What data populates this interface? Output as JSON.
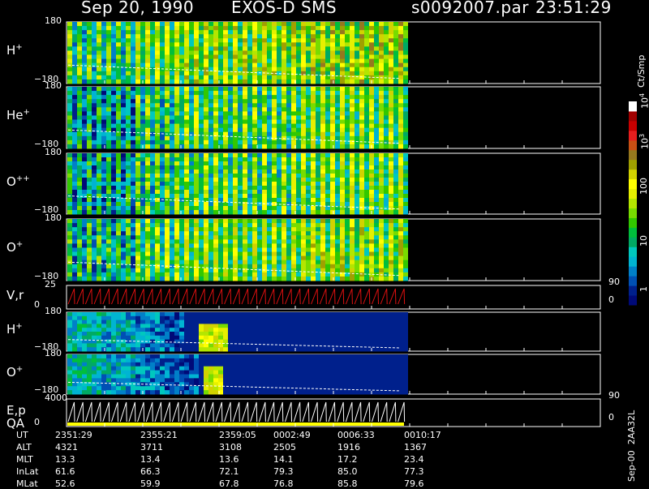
{
  "header": {
    "date": "Sep 20, 1990",
    "mission": "EXOS-D SMS",
    "file": "s0092007.par",
    "time": "23:51:29"
  },
  "colorbar": {
    "unit": "Ct/Smp",
    "labels": [
      "1",
      "10",
      "100",
      "10",
      "10"
    ],
    "label_superscripts": [
      "",
      "",
      "",
      "3",
      "4"
    ],
    "colors": [
      "#000a78",
      "#00208c",
      "#0050b4",
      "#0080c8",
      "#00b4d2",
      "#00c8be",
      "#00aa64",
      "#00be3c",
      "#32c800",
      "#78dc00",
      "#b4e600",
      "#e6f000",
      "#ffff00",
      "#d2d200",
      "#a0a000",
      "#96781e",
      "#c85014",
      "#e61e1e",
      "#c80000",
      "#a00000",
      "#ffffff"
    ]
  },
  "footer_label": "Sep-00  2AA32L",
  "ephemeris": {
    "rows": [
      {
        "label": "UT",
        "values": [
          "2351:29",
          "2355:21",
          "2359:05",
          "0002:49",
          "0006:33",
          "0010:17"
        ]
      },
      {
        "label": "ALT",
        "values": [
          "4321",
          "3711",
          "3108",
          "2505",
          "1916",
          "1367"
        ]
      },
      {
        "label": "MLT",
        "values": [
          "13.3",
          "13.4",
          "13.6",
          "14.1",
          "17.2",
          "23.4"
        ]
      },
      {
        "label": "InLat",
        "values": [
          "61.6",
          "66.3",
          "72.1",
          "79.3",
          "85.0",
          "77.3"
        ]
      },
      {
        "label": "MLat",
        "values": [
          "52.6",
          "59.9",
          "67.8",
          "76.8",
          "85.8",
          "79.6"
        ]
      }
    ]
  },
  "chart_data": {
    "type": "heatmap",
    "x_axis": {
      "label": "UT",
      "tick_labels": [
        "2351:29",
        "2355:21",
        "2359:05",
        "0002:49",
        "0006:33",
        "0010:17"
      ]
    },
    "panels": [
      {
        "name": "H",
        "superscript": "+",
        "type": "heatmap",
        "y_top_label": "180",
        "y_bottom_label": "−180"
      },
      {
        "name": "He",
        "superscript": "+",
        "type": "heatmap",
        "y_top_label": "180",
        "y_bottom_label": "−180"
      },
      {
        "name": "O",
        "superscript": "++",
        "type": "heatmap",
        "y_top_label": "180",
        "y_bottom_label": "−180"
      },
      {
        "name": "O",
        "superscript": "+",
        "type": "heatmap",
        "y_top_label": "180",
        "y_bottom_label": "−180"
      },
      {
        "name": "V,r",
        "superscript": "",
        "type": "line",
        "y_top_label": "25",
        "y_bottom_label": "0",
        "right_top_label": "90",
        "right_bottom_label": "0"
      },
      {
        "name": "H",
        "superscript": "+",
        "type": "heatmap",
        "y_top_label": "180",
        "y_bottom_label": "−180"
      },
      {
        "name": "O",
        "superscript": "+",
        "type": "heatmap",
        "y_top_label": "180",
        "y_bottom_label": "−180"
      },
      {
        "name": "E,p",
        "name2": "QA",
        "superscript": "",
        "type": "line",
        "y_top_label": "4000",
        "y_bottom_label": "0",
        "right_top_label": "90",
        "right_bottom_label": "0"
      }
    ]
  }
}
